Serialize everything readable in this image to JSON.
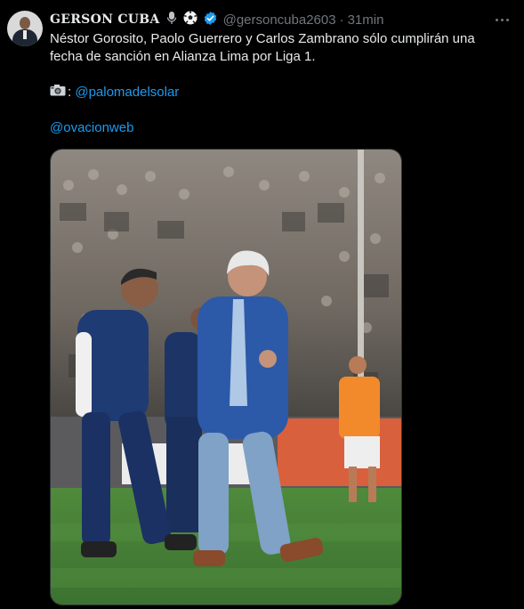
{
  "tweet": {
    "display_name": "GERSON CUBA",
    "handle": "@gersoncuba2603",
    "separator": "·",
    "time": "31min",
    "lines": [
      "Néstor Gorosito, Paolo Guerrero y Carlos Zambrano sólo cumplirán una",
      "fecha de sanción en Alianza Lima por Liga 1."
    ],
    "photo_credit_prefix": ":",
    "photo_credit_link": "@palomadelsolar",
    "mention_link": "@ovacionweb",
    "icons": [
      "microphone-emoji",
      "soccer-ball-emoji",
      "verified-badge",
      "more-options",
      "camera-emoji"
    ],
    "colors": {
      "background": "#000000",
      "text": "#e7e9ea",
      "secondary": "#71767b",
      "link": "#1d9bf0",
      "verified": "#1d9bf0"
    }
  }
}
